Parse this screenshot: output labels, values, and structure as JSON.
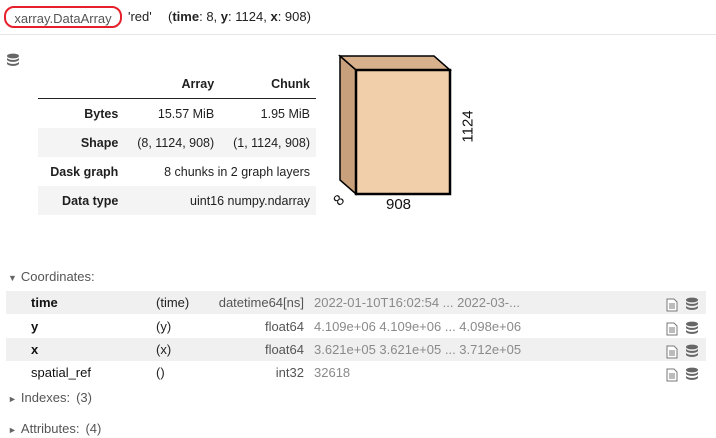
{
  "header": {
    "type_name": "xarray.DataArray",
    "var_name": "'red'",
    "dims": [
      {
        "name": "time",
        "size": "8"
      },
      {
        "name": "y",
        "size": "1124"
      },
      {
        "name": "x",
        "size": "908"
      }
    ]
  },
  "array_table": {
    "col_array": "Array",
    "col_chunk": "Chunk",
    "rows": [
      {
        "label": "Bytes",
        "array": "15.57 MiB",
        "chunk": "1.95 MiB"
      },
      {
        "label": "Shape",
        "array": "(8, 1124, 908)",
        "chunk": "(1, 1124, 908)"
      },
      {
        "label": "Dask graph",
        "value": "8 chunks in 2 graph layers"
      },
      {
        "label": "Data type",
        "value": "uint16 numpy.ndarray"
      }
    ]
  },
  "cube": {
    "label_time": "8",
    "label_x": "908",
    "label_y": "1124",
    "front_color": "#f2cfab",
    "side_color": "#c9a07c",
    "edge_color": "#000000"
  },
  "coordinates": {
    "header": "Coordinates:",
    "rows": [
      {
        "name": "time",
        "dims": "(time)",
        "dtype": "datetime64[ns]",
        "preview": "2022-01-10T16:02:54 ... 2022-03-..."
      },
      {
        "name": "y",
        "dims": "(y)",
        "dtype": "float64",
        "preview": "4.109e+06 4.109e+06 ... 4.098e+06"
      },
      {
        "name": "x",
        "dims": "(x)",
        "dtype": "float64",
        "preview": "3.621e+05 3.621e+05 ... 3.712e+05"
      },
      {
        "name": "spatial_ref",
        "dims": "()",
        "dtype": "int32",
        "preview": "32618"
      }
    ]
  },
  "indexes": {
    "label": "Indexes:",
    "count": "(3)"
  },
  "attributes": {
    "label": "Attributes:",
    "count": "(4)"
  },
  "icons": {
    "database": "database-icon",
    "document": "document-icon",
    "expanded": "triangle-down-icon",
    "collapsed": "triangle-right-icon"
  },
  "colors": {
    "highlight_ring": "#e5202a",
    "row_shade": "#f0f0f0",
    "muted_text": "#8a8a8a"
  }
}
